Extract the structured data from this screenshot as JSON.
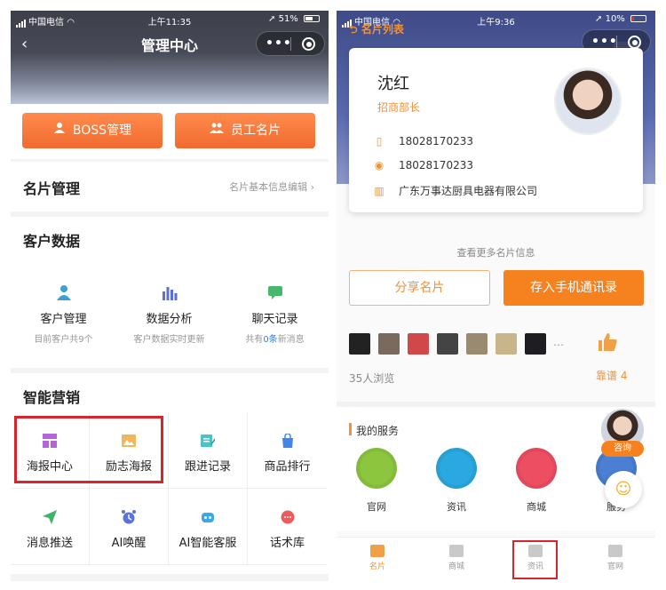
{
  "left": {
    "status": {
      "carrier": "中国电信",
      "time": "上午11:35",
      "battery": "51%",
      "battery_level": 0.51
    },
    "header": {
      "title": "管理中心",
      "menu_dots": "•••"
    },
    "top_buttons": {
      "boss": "BOSS管理",
      "staff": "员工名片"
    },
    "card_mgmt": {
      "title": "名片管理",
      "link": "名片基本信息编辑"
    },
    "customer": {
      "title": "客户数据",
      "items": [
        {
          "name": "客户管理",
          "desc": "目前客户共9个"
        },
        {
          "name": "数据分析",
          "desc": "客户数据实时更新"
        },
        {
          "name": "聊天记录",
          "desc_pre": "共有",
          "desc_num": "0条",
          "desc_post": "新消息"
        }
      ]
    },
    "marketing": {
      "title": "智能营销",
      "items": [
        {
          "label": "海报中心"
        },
        {
          "label": "励志海报"
        },
        {
          "label": "跟进记录"
        },
        {
          "label": "商品排行"
        },
        {
          "label": "消息推送"
        },
        {
          "label": "AI唤醒"
        },
        {
          "label": "AI智能客服"
        },
        {
          "label": "话术库"
        }
      ]
    }
  },
  "right": {
    "status": {
      "carrier": "中国电信",
      "time": "上午9:36",
      "battery": "10%",
      "battery_level": 0.1
    },
    "header": {
      "back_label": "名片列表"
    },
    "card": {
      "name": "沈红",
      "role": "招商部长",
      "phone": "18028170233",
      "wechat": "18028170233",
      "company": "广东万事达厨具电器有限公司"
    },
    "more_info": "查看更多名片信息",
    "share_button": "分享名片",
    "save_button": "存入手机通讯录",
    "views": "35人浏览",
    "likes": "靠谱 4",
    "services": {
      "title": "我的服务",
      "items": [
        {
          "label": "官网",
          "color": "#8cc63e"
        },
        {
          "label": "资讯",
          "color": "#2aa9e0"
        },
        {
          "label": "商城",
          "color": "#ee4e62"
        },
        {
          "label": "服务",
          "color": "#4a7fd4"
        }
      ]
    },
    "consult_label": "咨询",
    "tabs": [
      {
        "label": "名片",
        "active": true
      },
      {
        "label": "商城",
        "active": false
      },
      {
        "label": "资讯",
        "active": false
      },
      {
        "label": "官网",
        "active": false
      }
    ]
  }
}
